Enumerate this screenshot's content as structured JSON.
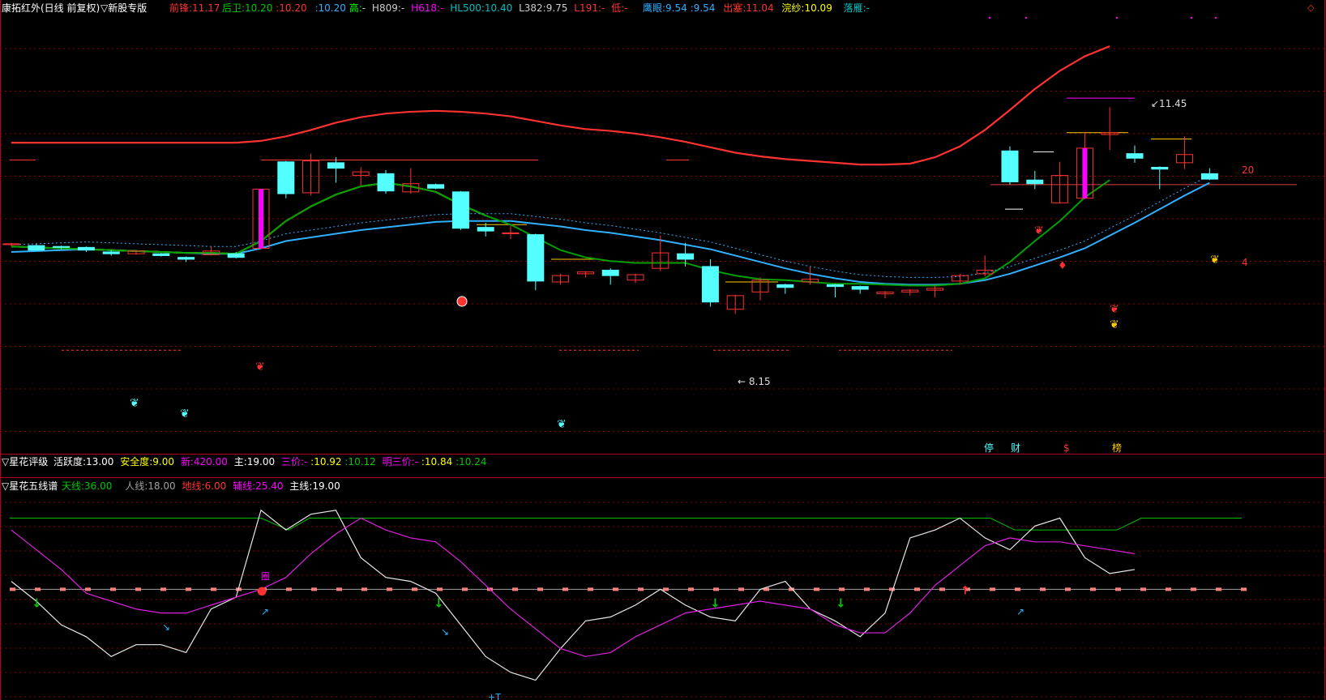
{
  "colors": {
    "up": "#ff3232",
    "down": "#54ffff",
    "qianfeng": "#ff3232",
    "houwei": "#00c800",
    "blue": "#30b0ff",
    "yellow": "#ffff00",
    "magenta": "#ff00ff",
    "white": "#ffffff",
    "grid": "#8b0000"
  },
  "header": {
    "title": "康拓红外(日线 前复权)",
    "menu_label": "▽新股专版",
    "qianfeng_label": "前锋:",
    "qianfeng_value": "11.17",
    "houwei_label": "后卫:",
    "houwei_value1": "10.20",
    "houwei_value2": ":10.20",
    "blue_value": ":10.20",
    "gao_label": "高:",
    "gao_value": "-",
    "h809_label": "H809:",
    "h809_value": "-",
    "h618_label": "H618:",
    "h618_value": "-",
    "hl500_label": "HL500:",
    "hl500_value": "10.40",
    "l382_label": "L382:",
    "l382_value": "9.75",
    "l191_label": "L191:",
    "l191_value": "-",
    "di_label": "低:",
    "di_value": "-",
    "yingyan_label": "鹰眼:",
    "yingyan_value1": "9.54",
    "yingyan_value2": ":9.54",
    "chusai_label": "出塞:",
    "chusai_value": "11.04",
    "huansha_label": "浣纱:",
    "huansha_value": "10.09",
    "luoyan_label": "落雁:",
    "luoyan_value": "-"
  },
  "price_labels": {
    "high": "11.45",
    "low": "8.15",
    "right_20": "20",
    "right_4": "4"
  },
  "markers": {
    "ting": "停",
    "cai": "财",
    "dollar": "$",
    "bang": "榜"
  },
  "panel2": {
    "title": "▽星花评级",
    "huoyue_label": "活跃度:",
    "huoyue_value": "13.00",
    "anquan_label": "安全度:",
    "anquan_value": "9.00",
    "xin_label": "新:",
    "xin_value": "420.00",
    "zhu_label": "主:",
    "zhu_value": "19.00",
    "sanjia_label": "三价:",
    "sanjia_v1": "-",
    "sanjia_v2": ":10.92",
    "sanjia_v3": ":10.12",
    "mingsanjia_label": "明三价:",
    "mingsanjia_v1": "-",
    "mingsanjia_v2": ":10.84",
    "mingsanjia_v3": ":10.24"
  },
  "panel3": {
    "title": "▽星花五线谱",
    "tianxian_label": "天线:",
    "tianxian_value": "36.00",
    "renxian_label": "人线:",
    "renxian_value": "18.00",
    "dixian_label": "地线:",
    "dixian_value": "6.00",
    "fuxian_label": "辅线:",
    "fuxian_value": "25.40",
    "zhuxian_label": "主线:",
    "zhuxian_value": "19.00",
    "mark_quan": "圈",
    "mark_t": "+T"
  },
  "chart_data": {
    "type": "candlestick",
    "candles": [
      {
        "o": 9.94,
        "h": 9.96,
        "l": 9.92,
        "c": 9.95
      },
      {
        "o": 9.93,
        "h": 9.95,
        "l": 9.88,
        "c": 9.88
      },
      {
        "o": 9.92,
        "h": 9.93,
        "l": 9.89,
        "c": 9.91
      },
      {
        "o": 9.91,
        "h": 9.92,
        "l": 9.86,
        "c": 9.88
      },
      {
        "o": 9.86,
        "h": 9.88,
        "l": 9.82,
        "c": 9.84
      },
      {
        "o": 9.84,
        "h": 9.88,
        "l": 9.83,
        "c": 9.87
      },
      {
        "o": 9.84,
        "h": 9.85,
        "l": 9.81,
        "c": 9.82
      },
      {
        "o": 9.8,
        "h": 9.81,
        "l": 9.75,
        "c": 9.78
      },
      {
        "o": 9.83,
        "h": 9.92,
        "l": 9.82,
        "c": 9.87
      },
      {
        "o": 9.84,
        "h": 9.86,
        "l": 9.79,
        "c": 9.8
      },
      {
        "o": 9.9,
        "h": 10.55,
        "l": 9.89,
        "c": 10.55
      },
      {
        "o": 10.85,
        "h": 10.86,
        "l": 10.45,
        "c": 10.5
      },
      {
        "o": 10.51,
        "h": 10.94,
        "l": 10.48,
        "c": 10.86
      },
      {
        "o": 10.84,
        "h": 10.9,
        "l": 10.62,
        "c": 10.78
      },
      {
        "o": 10.7,
        "h": 10.79,
        "l": 10.59,
        "c": 10.74
      },
      {
        "o": 10.72,
        "h": 10.76,
        "l": 10.5,
        "c": 10.53
      },
      {
        "o": 10.52,
        "h": 10.78,
        "l": 10.5,
        "c": 10.61
      },
      {
        "o": 10.6,
        "h": 10.61,
        "l": 10.55,
        "c": 10.56
      },
      {
        "o": 10.52,
        "h": 10.53,
        "l": 10.1,
        "c": 10.12
      },
      {
        "o": 10.13,
        "h": 10.18,
        "l": 10.03,
        "c": 10.09
      },
      {
        "o": 10.06,
        "h": 10.15,
        "l": 10.0,
        "c": 10.07
      },
      {
        "o": 10.05,
        "h": 10.06,
        "l": 9.44,
        "c": 9.54
      },
      {
        "o": 9.53,
        "h": 9.62,
        "l": 9.5,
        "c": 9.6
      },
      {
        "o": 9.62,
        "h": 9.65,
        "l": 9.58,
        "c": 9.64
      },
      {
        "o": 9.66,
        "h": 9.68,
        "l": 9.5,
        "c": 9.6
      },
      {
        "o": 9.55,
        "h": 9.62,
        "l": 9.52,
        "c": 9.61
      },
      {
        "o": 9.68,
        "h": 10.04,
        "l": 9.65,
        "c": 9.85
      },
      {
        "o": 9.84,
        "h": 9.96,
        "l": 9.7,
        "c": 9.78
      },
      {
        "o": 9.7,
        "h": 9.78,
        "l": 9.26,
        "c": 9.31
      },
      {
        "o": 9.23,
        "h": 9.39,
        "l": 9.18,
        "c": 9.38
      },
      {
        "o": 9.42,
        "h": 9.58,
        "l": 9.33,
        "c": 9.55
      },
      {
        "o": 9.5,
        "h": 9.51,
        "l": 9.4,
        "c": 9.47
      },
      {
        "o": 9.53,
        "h": 9.7,
        "l": 9.5,
        "c": 9.56
      },
      {
        "o": 9.5,
        "h": 9.51,
        "l": 9.36,
        "c": 9.48
      },
      {
        "o": 9.48,
        "h": 9.49,
        "l": 9.4,
        "c": 9.45
      },
      {
        "o": 9.4,
        "h": 9.43,
        "l": 9.35,
        "c": 9.42
      },
      {
        "o": 9.42,
        "h": 9.45,
        "l": 9.38,
        "c": 9.44
      },
      {
        "o": 9.44,
        "h": 9.49,
        "l": 9.36,
        "c": 9.46
      },
      {
        "o": 9.54,
        "h": 9.62,
        "l": 9.5,
        "c": 9.6
      },
      {
        "o": 9.62,
        "h": 9.82,
        "l": 9.59,
        "c": 9.66
      },
      {
        "o": 10.97,
        "h": 11.02,
        "l": 10.6,
        "c": 10.63
      },
      {
        "o": 10.65,
        "h": 10.75,
        "l": 10.55,
        "c": 10.61
      },
      {
        "o": 10.4,
        "h": 10.85,
        "l": 10.39,
        "c": 10.7
      },
      {
        "o": 10.45,
        "h": 11.18,
        "l": 10.44,
        "c": 11.0
      },
      {
        "o": 11.15,
        "h": 11.45,
        "l": 10.98,
        "c": 11.17
      },
      {
        "o": 10.94,
        "h": 11.03,
        "l": 10.84,
        "c": 10.89
      },
      {
        "o": 10.79,
        "h": 10.8,
        "l": 10.55,
        "c": 10.77
      },
      {
        "o": 10.84,
        "h": 11.13,
        "l": 10.77,
        "c": 10.93
      },
      {
        "o": 10.72,
        "h": 10.78,
        "l": 10.65,
        "c": 10.66
      }
    ],
    "ma_yellow_green": [
      9.92,
      9.91,
      9.9,
      9.89,
      9.88,
      9.87,
      9.86,
      9.85,
      9.85,
      9.84,
      9.98,
      10.2,
      10.36,
      10.49,
      10.58,
      10.62,
      10.58,
      10.52,
      10.38,
      10.26,
      10.16,
      10.02,
      9.88,
      9.8,
      9.76,
      9.74,
      9.74,
      9.74,
      9.66,
      9.6,
      9.56,
      9.55,
      9.53,
      9.51,
      9.51,
      9.5,
      9.49,
      9.49,
      9.51,
      9.57,
      9.75,
      9.98,
      10.2,
      10.46,
      10.65
    ],
    "ma_blue": [
      9.86,
      9.87,
      9.88,
      9.89,
      9.88,
      9.87,
      9.86,
      9.85,
      9.84,
      9.84,
      9.9,
      9.98,
      10.02,
      10.06,
      10.1,
      10.13,
      10.16,
      10.19,
      10.2,
      10.2,
      10.2,
      10.17,
      10.14,
      10.1,
      10.07,
      10.03,
      9.99,
      9.94,
      9.89,
      9.82,
      9.75,
      9.68,
      9.62,
      9.57,
      9.53,
      9.51,
      9.5,
      9.5,
      9.51,
      9.55,
      9.62,
      9.71,
      9.8,
      9.9,
      10.04,
      10.18,
      10.33,
      10.48,
      10.62
    ],
    "ma_red": [
      11.06,
      11.06,
      11.06,
      11.06,
      11.06,
      11.06,
      11.06,
      11.06,
      11.06,
      11.06,
      11.08,
      11.13,
      11.2,
      11.28,
      11.34,
      11.38,
      11.4,
      11.41,
      11.4,
      11.38,
      11.35,
      11.3,
      11.25,
      11.21,
      11.19,
      11.16,
      11.12,
      11.07,
      11.01,
      10.95,
      10.91,
      10.88,
      10.86,
      10.84,
      10.82,
      10.82,
      10.83,
      10.9,
      11.02,
      11.2,
      11.42,
      11.65,
      11.85,
      12.01,
      12.12
    ],
    "panel3_white": [
      20,
      15,
      9,
      6,
      1,
      4,
      4,
      2,
      13,
      16,
      38,
      33,
      37,
      38,
      26,
      21,
      20,
      17,
      9,
      1,
      -3,
      -5,
      3,
      10,
      11,
      14,
      18,
      14,
      11,
      10,
      18,
      20,
      13,
      10,
      6,
      12,
      31,
      33,
      36,
      31,
      28,
      34,
      36,
      26,
      22,
      23
    ],
    "panel3_magenta": [
      33,
      28,
      23,
      17,
      15,
      13,
      12,
      12,
      14,
      16,
      18,
      21,
      27,
      32,
      36,
      33,
      31,
      30,
      25,
      19,
      13,
      8,
      3,
      1,
      2,
      6,
      9,
      12,
      13,
      14,
      15,
      14,
      13,
      9,
      7,
      7,
      12,
      19,
      24,
      29,
      31,
      30,
      30,
      29,
      28,
      27
    ]
  }
}
